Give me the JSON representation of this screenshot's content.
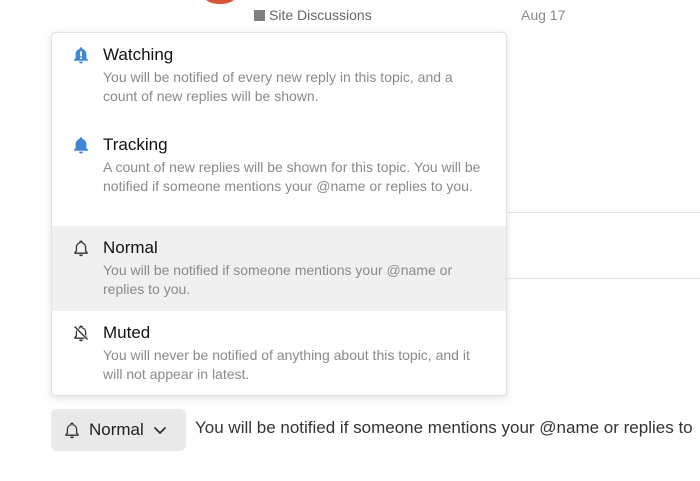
{
  "header": {
    "category": "Site Discussions",
    "date": "Aug 17"
  },
  "menu": {
    "options": [
      {
        "title": "Watching",
        "description": "You will be notified of every new reply in this topic, and a count of new replies will be shown.",
        "icon": "bell-exclamation-icon"
      },
      {
        "title": "Tracking",
        "description": "A count of new replies will be shown for this topic. You will be notified if someone mentions your @name or replies to you.",
        "icon": "bell-filled-icon"
      },
      {
        "title": "Normal",
        "description": "You will be notified if someone mentions your @name or replies to you.",
        "icon": "bell-outline-icon"
      },
      {
        "title": "Muted",
        "description": "You will never be notified of anything about this topic, and it will not appear in latest.",
        "icon": "bell-slash-icon"
      }
    ]
  },
  "notification_button": {
    "label": "Normal",
    "icon": "bell-outline-icon"
  },
  "footer_text": "You will be notified if someone mentions your @name or replies to",
  "colors": {
    "accent_blue": "#3f86d6",
    "selected_bg": "#f0f0f0",
    "button_bg": "#e9e9e9"
  }
}
